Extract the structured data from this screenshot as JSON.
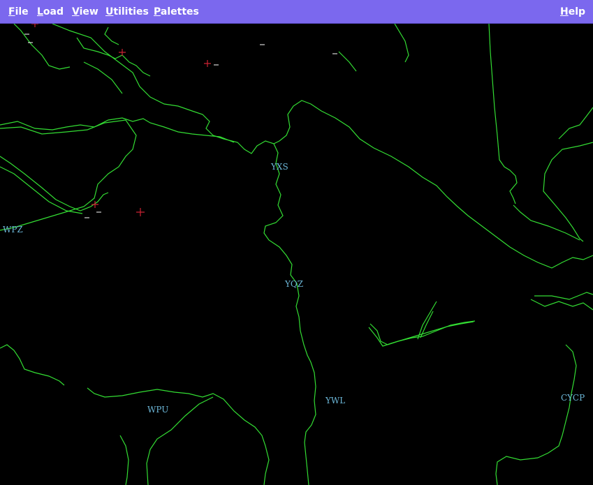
{
  "menu": {
    "file": {
      "mnemonic": "F",
      "rest": "ile"
    },
    "load": {
      "mnemonic": "L",
      "rest": "oad"
    },
    "view": {
      "mnemonic": "V",
      "rest": "iew"
    },
    "utilities": {
      "mnemonic": "U",
      "rest": "tilities"
    },
    "palettes": {
      "mnemonic": "P",
      "rest": "alettes"
    },
    "help": {
      "mnemonic": "H",
      "rest": "elp"
    }
  },
  "stations": {
    "yxs": "YXS",
    "wpz": "WPZ",
    "yqz": "YQZ",
    "ywl": "YWL",
    "wpu": "WPU",
    "cycp": "CYCP"
  },
  "colors": {
    "menubar": "#7b68ee",
    "map_background": "#000000",
    "border_lines": "#33dd33",
    "station_labels": "#6cb7d8",
    "markers": "#cc2233"
  }
}
